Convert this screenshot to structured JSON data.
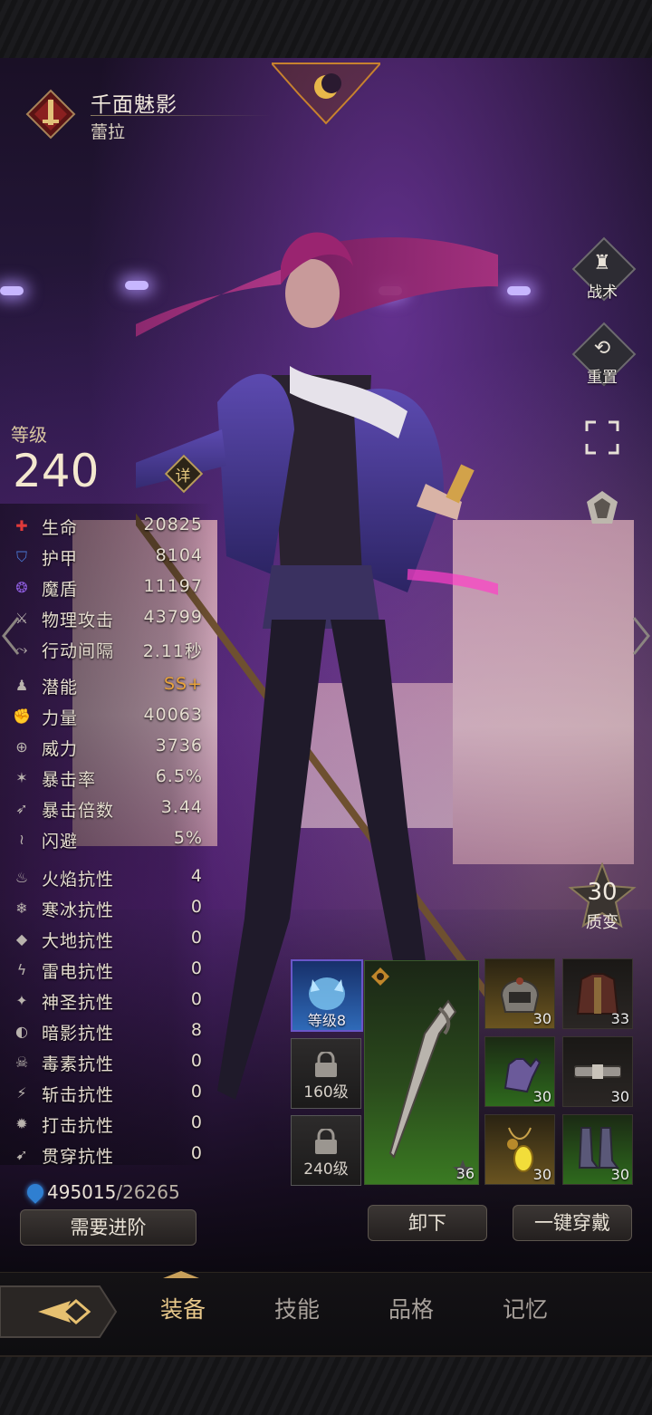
{
  "hero": {
    "title": "千面魅影",
    "name": "蕾拉"
  },
  "side_buttons": [
    {
      "label": "战术",
      "icon": "tactics-icon"
    },
    {
      "label": "重置",
      "icon": "reset-icon"
    },
    {
      "label": "",
      "icon": "fullscreen-icon"
    },
    {
      "label": "",
      "icon": "outfit-icon"
    }
  ],
  "level": {
    "label": "等级",
    "value": "240",
    "detail_label": "详"
  },
  "stats": [
    {
      "name": "生命",
      "value": "20825",
      "icon": "health-icon"
    },
    {
      "name": "护甲",
      "value": "8104",
      "icon": "armor-icon"
    },
    {
      "name": "魔盾",
      "value": "11197",
      "icon": "magic-shield-icon"
    },
    {
      "name": "物理攻击",
      "value": "43799",
      "icon": "physical-attack-icon"
    },
    {
      "name": "行动间隔",
      "value": "2.11秒",
      "icon": "action-interval-icon"
    },
    {
      "name": "潜能",
      "value": "SS+",
      "icon": "potential-icon",
      "color": "#e8a23a"
    },
    {
      "name": "力量",
      "value": "40063",
      "icon": "strength-icon"
    },
    {
      "name": "威力",
      "value": "3736",
      "icon": "power-icon"
    },
    {
      "name": "暴击率",
      "value": "6.5%",
      "icon": "crit-rate-icon"
    },
    {
      "name": "暴击倍数",
      "value": "3.44",
      "icon": "crit-multiplier-icon"
    },
    {
      "name": "闪避",
      "value": "5%",
      "icon": "dodge-icon"
    },
    {
      "name": "火焰抗性",
      "value": "4",
      "icon": "fire-resist-icon"
    },
    {
      "name": "寒冰抗性",
      "value": "0",
      "icon": "ice-resist-icon"
    },
    {
      "name": "大地抗性",
      "value": "0",
      "icon": "earth-resist-icon"
    },
    {
      "name": "雷电抗性",
      "value": "0",
      "icon": "lightning-resist-icon"
    },
    {
      "name": "神圣抗性",
      "value": "0",
      "icon": "holy-resist-icon"
    },
    {
      "name": "暗影抗性",
      "value": "8",
      "icon": "shadow-resist-icon"
    },
    {
      "name": "毒素抗性",
      "value": "0",
      "icon": "poison-resist-icon"
    },
    {
      "name": "斩击抗性",
      "value": "0",
      "icon": "slash-resist-icon"
    },
    {
      "name": "打击抗性",
      "value": "0",
      "icon": "blunt-resist-icon"
    },
    {
      "name": "贯穿抗性",
      "value": "0",
      "icon": "pierce-resist-icon"
    }
  ],
  "currency": {
    "current": "495015",
    "separator": "/",
    "required": "26265"
  },
  "advance_button": "需要进阶",
  "quality": {
    "value": "30",
    "label": "质变"
  },
  "pet_slot": {
    "label": "等级8"
  },
  "locked_slots": [
    "160级",
    "240级"
  ],
  "weapon": {
    "level": "36"
  },
  "equipment": [
    {
      "name": "helmet",
      "level": "30",
      "rarity": "gold"
    },
    {
      "name": "armor",
      "level": "33",
      "rarity": "plain"
    },
    {
      "name": "gloves",
      "level": "30",
      "rarity": "green"
    },
    {
      "name": "belt",
      "level": "30",
      "rarity": "plain"
    },
    {
      "name": "amulet",
      "level": "30",
      "rarity": "gold"
    },
    {
      "name": "boots",
      "level": "30",
      "rarity": "green"
    }
  ],
  "actions": {
    "unequip": "卸下",
    "auto_equip": "一键穿戴"
  },
  "tabs": [
    {
      "label": "装备",
      "active": true
    },
    {
      "label": "技能",
      "active": false
    },
    {
      "label": "品格",
      "active": false
    },
    {
      "label": "记忆",
      "active": false
    }
  ]
}
